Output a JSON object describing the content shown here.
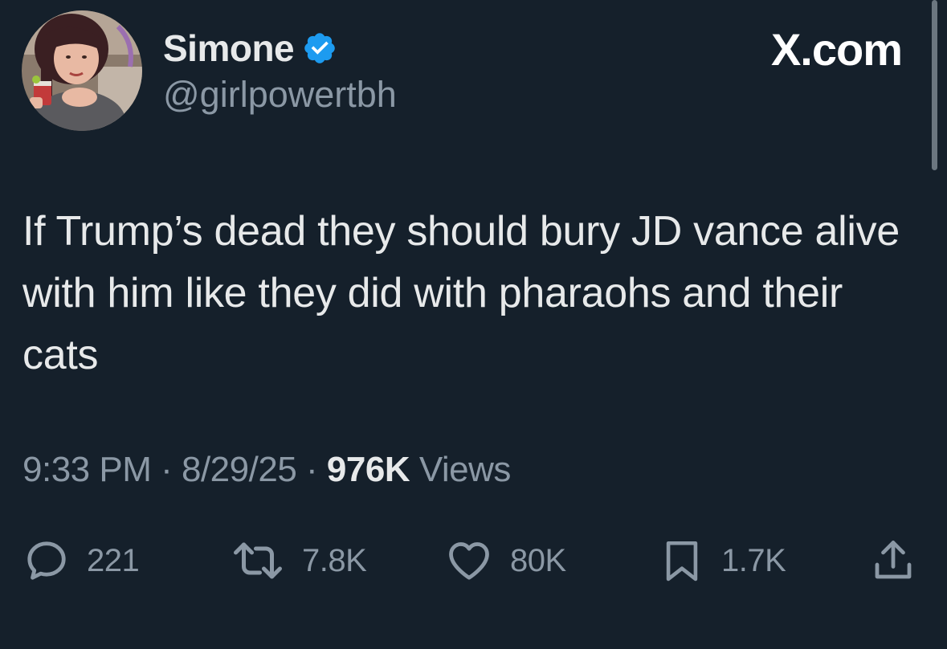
{
  "user": {
    "display_name": "Simone",
    "handle": "@girlpowertbh",
    "verified_icon": "verified-badge-icon",
    "avatar": "profile-photo"
  },
  "brand": {
    "label": "X.com"
  },
  "tweet": {
    "text": "If Trump’s dead they should bury JD vance alive with him like they did with pharaohs and their cats",
    "time": "9:33 PM",
    "separator": " · ",
    "date": "8/29/25",
    "views_count": "976K",
    "views_label": "Views"
  },
  "actions": {
    "replies": {
      "count": "221",
      "icon": "reply-icon"
    },
    "reposts": {
      "count": "7.8K",
      "icon": "repost-icon"
    },
    "likes": {
      "count": "80K",
      "icon": "heart-icon"
    },
    "bookmarks": {
      "count": "1.7K",
      "icon": "bookmark-icon"
    },
    "share": {
      "icon": "share-icon"
    }
  },
  "colors": {
    "background": "#15202b",
    "primary_text": "#e7e9ea",
    "secondary_text": "#8b98a5",
    "verified_blue": "#1d9bf0"
  }
}
